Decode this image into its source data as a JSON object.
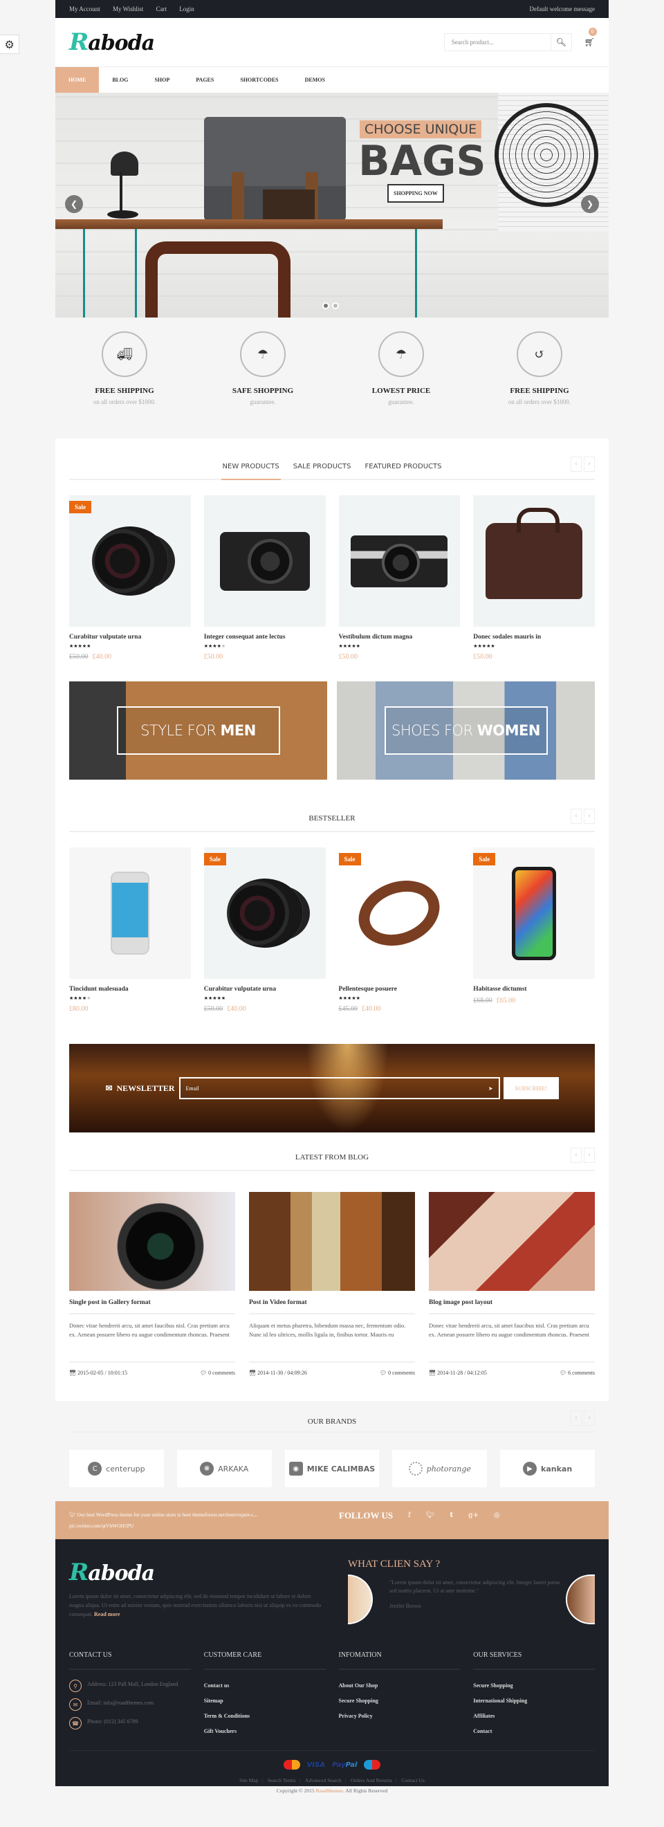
{
  "topbar": {
    "links": [
      "My Account",
      "My Wishlist",
      "Cart",
      "Login"
    ],
    "welcome": "Default welcome message"
  },
  "header": {
    "logo_first": "R",
    "logo_rest": "aboda",
    "search_placeholder": "Search product...",
    "cart_count": "0"
  },
  "nav": {
    "items": [
      "HOME",
      "BLOG",
      "SHOP",
      "PAGES",
      "SHORTCODES",
      "DEMOS"
    ],
    "active": "HOME"
  },
  "hero": {
    "kicker": "CHOOSE UNIQUE",
    "title": "BAGS",
    "button": "SHOPPING NOW",
    "slide_count": 2,
    "active_slide": 1
  },
  "services": [
    {
      "icon": "truck-icon",
      "title": "FREE SHIPPING",
      "subtitle": "on all orders over $1000."
    },
    {
      "icon": "umbrella-icon",
      "title": "SAFE SHOPPING",
      "subtitle": "guarantee."
    },
    {
      "icon": "umbrella-icon",
      "title": "LOWEST PRICE",
      "subtitle": "guarantee."
    },
    {
      "icon": "history-icon",
      "title": "FREE SHIPPING",
      "subtitle": "on all orders over $1000."
    }
  ],
  "products_section": {
    "tabs": [
      "NEW PRODUCTS",
      "SALE PRODUCTS",
      "FEATURED PRODUCTS"
    ],
    "active_tab": "NEW PRODUCTS",
    "items": [
      {
        "name": "Curabitur vulputate urna",
        "rating": 5,
        "old_price": "£50.00",
        "price": "£40.00",
        "sale": "Sale"
      },
      {
        "name": "Integer consequat ante lectus",
        "rating": 4,
        "old_price": "",
        "price": "£50.00",
        "sale": ""
      },
      {
        "name": "Vestibulum dictum magna",
        "rating": 5,
        "old_price": "",
        "price": "£50.00",
        "sale": ""
      },
      {
        "name": "Donec sodales mauris in",
        "rating": 5,
        "old_price": "",
        "price": "£50.00",
        "sale": ""
      }
    ]
  },
  "banners": [
    {
      "light": "STYLE FOR",
      "bold": "MEN"
    },
    {
      "light": "SHOES FOR",
      "bold": "WOMEN"
    }
  ],
  "bestseller": {
    "title": "BESTSELLER",
    "items": [
      {
        "name": "Tincidunt malesuada",
        "rating": 4,
        "old_price": "",
        "price": "£80.00",
        "sale": ""
      },
      {
        "name": "Curabitur vulputate urna",
        "rating": 5,
        "old_price": "£50.00",
        "price": "£40.00",
        "sale": "Sale"
      },
      {
        "name": "Pellentesque posuere",
        "rating": 5,
        "old_price": "£45.00",
        "price": "£40.00",
        "sale": "Sale"
      },
      {
        "name": "Habitasse dictumst",
        "rating": 0,
        "old_price": "£68.00",
        "price": "£65.00",
        "sale": "Sale"
      }
    ]
  },
  "newsletter": {
    "label": "NEWSLETTER",
    "placeholder": "Email",
    "button": "SUBSCRIBE!"
  },
  "blog": {
    "title": "LATEST FROM BLOG",
    "posts": [
      {
        "title": "Single post in Gallery format",
        "excerpt": "Donec vitae hendrerit arcu, sit amet faucibus nisl. Cras pretium arcu ex. Aenean posuere libero eu augue condimentum rhoncus. Praesent",
        "date": "2015-02-05 / 10:01:15",
        "comments": "0 comments"
      },
      {
        "title": "Post in Video format",
        "excerpt": "Aliquam et metus pharetra, bibendum massa nec, fermentum odio. Nunc id leo ultrices, mollis ligula in, finibus tortor. Mauris eu",
        "date": "2014-11-30 / 04:09:26",
        "comments": "0 comments"
      },
      {
        "title": "Blog image post layout",
        "excerpt": "Donec vitae hendrerit arcu, sit amet faucibus nisl. Cras pretium arcu ex. Aenean posuere libero eu augue condimentum rhoncus. Praesent",
        "date": "2014-11-28 / 04:12:05",
        "comments": "6 comments"
      }
    ]
  },
  "brands": {
    "title": "OUR BRANDS",
    "items": [
      "centerupp",
      "ARKAKA",
      "MIKE CALIMBAS",
      "photorange",
      "kankan"
    ]
  },
  "social": {
    "tweet_line1": "Our best WordPress theme for your online store is here themeforest.net/item/expert-c...",
    "tweet_line2": "pic.twitter.com/qtVhWOH5PU",
    "follow_label": "FOLLOW US",
    "icons": [
      "facebook-icon",
      "twitter-icon",
      "tumblr-icon",
      "google-plus-icon",
      "dribbble-icon"
    ]
  },
  "footer": {
    "about": "Lorem ipsum dolor sit amet, consectetur adipiscing elit, sed do eiusmod tempor incididunt ut labore et dolore magna aliqua. Ut enim ad minim veniam, quis nostrud exercitation ullamco laboris nisi ut aliquip ex ea commodo consequat.",
    "read_more": "Read more",
    "testimonial_title": "WHAT CLIEN SAY ?",
    "testimonial_quote": "\"Lorem ipsum dolor sit amet, consectetur adipiscing elit. Integer laoret purus sed mattis placerat. Ut at ante molestie.\"",
    "testimonial_author": "Jenifer Brown",
    "contact_title": "CONTACT US",
    "address": "Address: 123 Pall Mall, London England",
    "email": "Email: info@roadthemes.com",
    "phone": "Phone: (012) 345 6789",
    "columns": [
      {
        "title": "CUSTOMER CARE",
        "links": [
          "Contact us",
          "Sitemap",
          "Term & Conditions",
          "Gift Vouchers"
        ]
      },
      {
        "title": "INFOMATION",
        "links": [
          "About Our Shop",
          "Secure Shopping",
          "Privacy Policy"
        ]
      },
      {
        "title": "OUR SERVICES",
        "links": [
          "Secure Shopping",
          "International Shipping",
          "Affiliates",
          "Contact"
        ]
      }
    ],
    "payments": [
      "MasterCard",
      "VISA",
      "PayPal",
      "Maestro"
    ],
    "bottom_links": [
      "Site Map",
      "Search Terms",
      "Advanced Search",
      "Orders And Returns",
      "Contact Us"
    ],
    "copyright_pre": "Copyright © 2015",
    "copyright_brand": "Roadthemes.",
    "copyright_post": "All Rights Reserved"
  },
  "colors": {
    "accent": "#e6b18f",
    "sale_badge": "#e8690f",
    "dark": "#1d2027",
    "logo_teal": "#2ebfa5"
  }
}
